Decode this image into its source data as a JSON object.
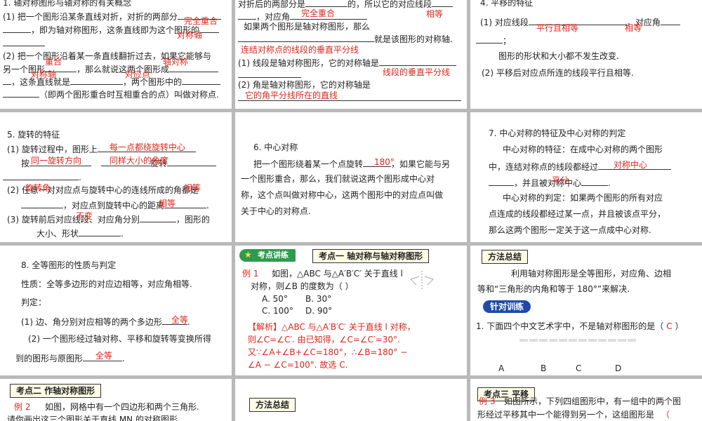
{
  "cell1": {
    "line1": "1. 轴对称图形与轴对称的有关概念",
    "line2": "(1) 把一个图形沿某条直线对折，对折的两部分",
    "line3": "，即为轴对称图形，这条直线即为这个图形的",
    "line5": "(2) 把一个图形沿着某一条直线翻折过去，如果它能够与",
    "line6": "另一个图形",
    "line6b": "，那么就说这两个图形成",
    "line7": "，这条直线就是",
    "line7b": "，两个图形中的",
    "line8": "（即两个图形重合时互相重合的点）叫做对称点.",
    "ans1": "完全重合",
    "ans2": "对称轴",
    "ans3": "重合",
    "ans4": "轴对称",
    "ans5": "对称轴",
    "ans6": "对应点"
  },
  "cell2": {
    "line1": "对折后的两部分是",
    "line1b": "的，所以它的对应线段",
    "line2": "，对应角",
    "line3": "如果两个图形是轴对称图形，那么",
    "line4": "就是该图形的对称轴.",
    "line6": "(1) 线段是轴对称图形，它的对称轴是",
    "line8": "(2) 角是轴对称图形，它的对称轴是",
    "ans1": "完全重合",
    "ans2": "相等",
    "ans3": "连结对称点的线段的垂直平分线",
    "ans4": "线段的垂直平分线",
    "ans5": "它的角平分线所在的直线"
  },
  "cell3": {
    "line1": "4. 平移的特征",
    "line2": "(1) 对应线段",
    "line2b": "，对应角",
    "line4": "图形的形状和大小都不发生改变.",
    "line5": "(2) 平移后对应点所连的线段平行且相等.",
    "ans1": "平行且相等",
    "ans2": "相等"
  },
  "cell4": {
    "line1": "5. 旋转的特征",
    "line2": "(1) 旋转过程中，图形上",
    "line3": "按",
    "line3b": "旋转",
    "line5": "(2) 任意一对对应点与旋转中心的连线所成的角都是",
    "line6": "，对应点到旋转中心的距离",
    "line7": "(3) 旋转前后对应线段、对应角分别",
    "line7b": "，图形的",
    "line8": "大小、形状",
    "ans1": "每一点都绕旋转中心",
    "ans2": "同一旋转方向",
    "ans3": "同样大小的角度",
    "ans4": "旋转角",
    "ans5": "相等",
    "ans6": "相等",
    "ans7": "不变"
  },
  "cell5": {
    "line1": "6. 中心对称",
    "line2": "把一个图形绕着某一个点旋转",
    "line2b": "，如果它能与另",
    "line3": "一个图形重合，那么，我们就说这两个图形成中心对",
    "line4": "称，这个点叫做对称中心，这两个图形中的对应点叫做",
    "line5": "关于中心的对称点.",
    "ans1": "180°"
  },
  "cell6": {
    "line1": "7. 中心对称的特征及中心对称的判定",
    "line2": "中心对称的特征：在成中心对称的两个图形",
    "line3": "中，连结对称点的线段都经过",
    "line4": "，并且被对称中心",
    "line5": "中心对称的判定：如果两个图形的所有对应",
    "line6": "点连成的线段都经过某一点，并且被该点平分，",
    "line7": "那么这两个图形一定关于这一点成中心对称.",
    "ans1": "对称中心",
    "ans2": "平分"
  },
  "cell7": {
    "line1": "8. 全等图形的性质与判定",
    "line2": "性质：全等多边形的对应边相等，对应角相等.",
    "line3": "判定：",
    "line4": "(1) 边、角分别对应相等的两个多边形",
    "line5": "(2) 一个图形经过轴对称、平移和旋转等变换所得",
    "line6": "到的图形与原图形",
    "ans1": "全等",
    "ans2": "全等"
  },
  "cell8": {
    "ribbon": "考点讲练",
    "header": "考点一 轴对称与轴对称图形",
    "ex_label": "例 1",
    "q1": "如图，△ABC 与△A′B′C′ 关于直线 l",
    "q2": "对称，则∠B 的度数为（    ）",
    "optA": "A. 50°",
    "optB": "B. 30°",
    "optC": "C. 100°",
    "optD": "D. 90°",
    "sol1": "【解析】△ABC 与△A′B′C′ 关于直线 l 对称，",
    "sol2": "则∠C=∠C′. 由已知得，∠C=∠C′=30°.",
    "sol3": "又∵∠A+∠B+∠C=180°，∴∠B=180° −",
    "sol4": "∠A − ∠C=100°. 故选 C."
  },
  "cell9": {
    "header": "方法总结",
    "line1": "利用轴对称图形是全等图形，对应角、边相",
    "line2": "等和“三角形的内角和等于 180°”来解决.",
    "pill": "针对训练",
    "q1": "1. 下面四个中文艺术字中，不是轴对称图形的是（",
    "q1ans": "C",
    "q1end": "）",
    "opts": [
      "A",
      "B",
      "C",
      "D"
    ]
  },
  "cell10": {
    "header": "考点二 作轴对称图形",
    "ex_label": "例 2",
    "line1": "如图，网格中有一个四边形和两个三角形.",
    "line2": "请你画出这三个图形关于直线 MN 的对称图形"
  },
  "cell11": {
    "header": "方法总结"
  },
  "cell12": {
    "header": "考点三 平移",
    "ex_label": "例 3",
    "line1": "如图所示，下列四组图形中，有一组中的两个图",
    "line2": "形经过平移其中一个能得到另一个，这组图形是",
    "ans": "（"
  }
}
